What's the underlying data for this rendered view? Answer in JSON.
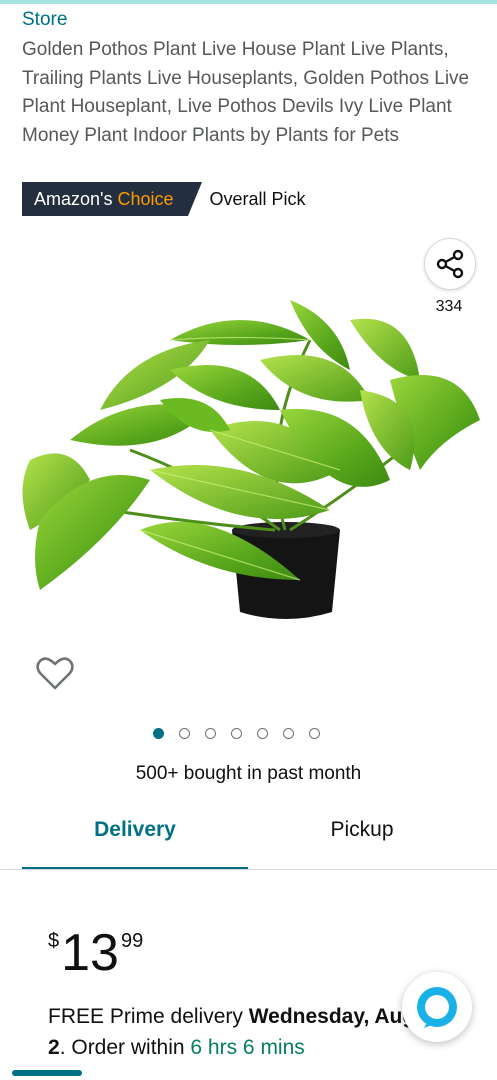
{
  "store_link": "Store",
  "product": {
    "title": "Golden Pothos Plant Live House Plant Live Plants, Trailing Plants Live Houseplants, Golden Pothos Live Plant Houseplant, Live Pothos Devils Ivy Live Plant Money Plant Indoor Plants by Plants for Pets",
    "badge_prefix": "Amazon's",
    "badge_choice": "Choice",
    "badge_pick": "Overall Pick",
    "share_count": "334",
    "image_icon": "golden-pothos-plant-image",
    "gallery": {
      "total": 7,
      "active_index": 0
    },
    "bought": "500+ bought in past month"
  },
  "tabs": [
    {
      "label": "Delivery",
      "active": true
    },
    {
      "label": "Pickup",
      "active": false
    }
  ],
  "price": {
    "symbol": "$",
    "whole": "13",
    "fraction": "99"
  },
  "delivery": {
    "prefix": "FREE Prime delivery ",
    "date": "Wednesday, August 2",
    "middle": ". Order within ",
    "countdown": "6 hrs 6 mins"
  },
  "colors": {
    "teal": "#007185",
    "badge_dark": "#232f3e",
    "choice_orange": "#ff9900",
    "countdown_green": "#067d62",
    "leaf_green": "#7cc32a"
  },
  "icons": {
    "share": "share-icon",
    "heart": "heart-icon",
    "alexa": "alexa-icon"
  }
}
